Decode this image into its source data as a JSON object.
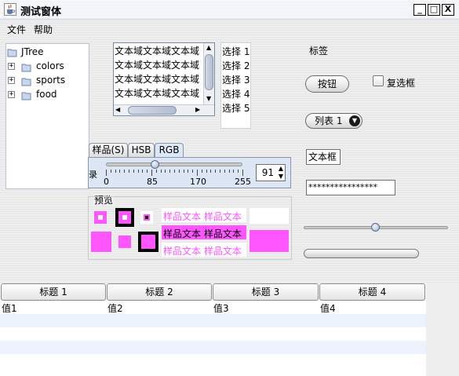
{
  "window": {
    "title": "测试窗体",
    "buttons": [
      "_",
      "□",
      "X"
    ]
  },
  "menu": [
    "文件",
    "帮助"
  ],
  "tree": {
    "root": "JTree",
    "children": [
      "colors",
      "sports",
      "food"
    ]
  },
  "text_area": {
    "lines": [
      "文本域文本域文本域",
      "文本域文本域文本域",
      "文本域文本域文本域",
      "文本域文本域文本域"
    ]
  },
  "list": {
    "items": [
      "选择 1",
      "选择 2",
      "选择 3",
      "选择 4",
      "选择 5"
    ]
  },
  "right_panel": {
    "label": "标签",
    "button": "按钮",
    "checkbox_label": "复选框",
    "checkbox_checked": false,
    "combo_value": "列表 1",
    "text_field": "文本框",
    "password": "****************",
    "slider_value": 0.5,
    "progress_value": 0
  },
  "color_chooser": {
    "tabs": [
      "样品(S)",
      "HSB",
      "RGB"
    ],
    "active_tab": "RGB",
    "channel_label": "录",
    "ticks": [
      "0",
      "85",
      "170",
      "255"
    ],
    "value": "91",
    "preview_label": "预览",
    "sample_text": "样品文本  样品文本",
    "preview_color": "#ff55ff"
  },
  "table": {
    "headers": [
      "标题 1",
      "标题 2",
      "标题 3",
      "标题 4"
    ],
    "rows": [
      [
        "值1",
        "值2",
        "值3",
        "值4"
      ],
      [
        "",
        "",
        "",
        ""
      ],
      [
        "",
        "",
        "",
        ""
      ],
      [
        "",
        "",
        "",
        ""
      ]
    ]
  }
}
